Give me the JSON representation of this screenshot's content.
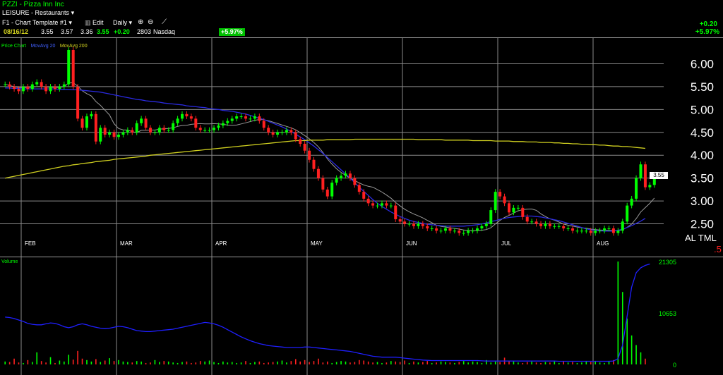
{
  "header": {
    "symbol_line": "PZZI - Pizza Inn Inc",
    "sector": "LEISURE - Restaurants",
    "template": "F1 - Chart Template #1",
    "edit_label": "Edit",
    "period": "Daily",
    "quote": {
      "date": "08/16/12",
      "open": "3.55",
      "high": "3.57",
      "low": "3.36",
      "close": "3.55",
      "change": "+0.20",
      "volume": "2803",
      "exchange": "Nasdaq"
    },
    "pct_badge": "+5.97%",
    "right_change": "+0.20",
    "right_pct": "+5.97%"
  },
  "price_panel": {
    "legend_title": "Price Chart",
    "legend_ma20": "MovAvg 20",
    "legend_ma200": "MovAvg 200",
    "last_price_label": "3.55",
    "corner_text": "AL TML",
    "corner_sub": ".5"
  },
  "volume_panel": {
    "legend_title": "Volume"
  },
  "colors": {
    "up": "#00ff00",
    "down": "#ff2020",
    "ma20": "#2a2ae0",
    "ma200": "#d0d020",
    "thin_ma": "#9a9a9a",
    "grid": "#8a8a8a",
    "axis_text": "#ffffff",
    "volume_line": "#1f1fff"
  },
  "chart_data": [
    {
      "type": "candlestick",
      "title": "PZZI - Pizza Inn Inc",
      "months": [
        "FEB",
        "MAR",
        "APR",
        "MAY",
        "JUN",
        "JUL",
        "AUG"
      ],
      "y_ticks": [
        "6.00",
        "5.50",
        "5.00",
        "4.50",
        "4.00",
        "3.50",
        "3.00",
        "2.50"
      ],
      "ylim": [
        2.0,
        6.5
      ],
      "close": [
        5.55,
        5.5,
        5.45,
        5.4,
        5.5,
        5.45,
        5.55,
        5.6,
        5.5,
        5.4,
        5.5,
        5.45,
        5.5,
        5.55,
        6.3,
        5.5,
        4.8,
        4.6,
        4.85,
        4.9,
        4.3,
        4.6,
        4.45,
        4.5,
        4.4,
        4.45,
        4.5,
        4.55,
        4.5,
        4.7,
        4.8,
        4.6,
        4.5,
        4.5,
        4.6,
        4.55,
        4.55,
        4.7,
        4.8,
        4.9,
        4.85,
        4.8,
        4.6,
        4.55,
        4.55,
        4.55,
        4.6,
        4.65,
        4.7,
        4.75,
        4.8,
        4.85,
        4.85,
        4.8,
        4.8,
        4.85,
        4.75,
        4.6,
        4.5,
        4.45,
        4.5,
        4.5,
        4.55,
        4.5,
        4.35,
        4.25,
        4.1,
        3.9,
        3.7,
        3.5,
        3.25,
        3.1,
        3.4,
        3.5,
        3.55,
        3.6,
        3.5,
        3.35,
        3.2,
        3.05,
        2.95,
        2.9,
        2.9,
        2.95,
        2.9,
        2.9,
        2.6,
        2.55,
        2.5,
        2.5,
        2.45,
        2.5,
        2.45,
        2.4,
        2.4,
        2.35,
        2.35,
        2.4,
        2.35,
        2.35,
        2.3,
        2.3,
        2.35,
        2.35,
        2.4,
        2.45,
        2.5,
        2.8,
        3.2,
        3.1,
        2.95,
        2.75,
        2.85,
        2.85,
        2.65,
        2.55,
        2.55,
        2.5,
        2.45,
        2.5,
        2.45,
        2.45,
        2.45,
        2.4,
        2.4,
        2.35,
        2.35,
        2.35,
        2.35,
        2.3,
        2.35,
        2.35,
        2.4,
        2.4,
        2.3,
        2.35,
        2.55,
        2.9,
        3.05,
        3.5,
        3.8,
        3.3,
        3.35,
        3.55
      ],
      "ma20": [
        5.47,
        5.47,
        5.46,
        5.46,
        5.45,
        5.45,
        5.45,
        5.45,
        5.45,
        5.45,
        5.45,
        5.45,
        5.44,
        5.44,
        5.44,
        5.43,
        5.43,
        5.42,
        5.41,
        5.4,
        5.39,
        5.38,
        5.36,
        5.34,
        5.32,
        5.3,
        5.28,
        5.26,
        5.24,
        5.22,
        5.21,
        5.19,
        5.18,
        5.17,
        5.16,
        5.14,
        5.13,
        5.12,
        5.11,
        5.1,
        5.08,
        5.07,
        5.06,
        5.05,
        5.04,
        5.02,
        5.01,
        5.0,
        4.98,
        4.97,
        4.96,
        4.94,
        4.92,
        4.9,
        4.87,
        4.84,
        4.81,
        4.78,
        4.74,
        4.7,
        4.66,
        4.62,
        4.57,
        4.52,
        4.46,
        4.4,
        4.34,
        4.27,
        4.2,
        4.12,
        4.04,
        3.95,
        3.86,
        3.77,
        3.68,
        3.59,
        3.5,
        3.4,
        3.3,
        3.21,
        3.12,
        3.03,
        2.95,
        2.88,
        2.82,
        2.76,
        2.71,
        2.66,
        2.62,
        2.58,
        2.55,
        2.53,
        2.51,
        2.49,
        2.48,
        2.47,
        2.46,
        2.45,
        2.45,
        2.45,
        2.45,
        2.45,
        2.46,
        2.47,
        2.48,
        2.5,
        2.52,
        2.55,
        2.57,
        2.6,
        2.62,
        2.64,
        2.65,
        2.66,
        2.67,
        2.67,
        2.67,
        2.66,
        2.65,
        2.63,
        2.61,
        2.59,
        2.57,
        2.54,
        2.51,
        2.48,
        2.45,
        2.42,
        2.39,
        2.37,
        2.36,
        2.35,
        2.34,
        2.34,
        2.34,
        2.36,
        2.38,
        2.42,
        2.46,
        2.51,
        2.56,
        2.62
      ],
      "ma200": [
        3.5,
        3.52,
        3.54,
        3.56,
        3.58,
        3.6,
        3.62,
        3.64,
        3.66,
        3.68,
        3.7,
        3.72,
        3.74,
        3.76,
        3.77,
        3.79,
        3.8,
        3.82,
        3.83,
        3.84,
        3.86,
        3.87,
        3.88,
        3.89,
        3.91,
        3.92,
        3.93,
        3.94,
        3.95,
        3.96,
        3.97,
        3.98,
        4.0,
        4.01,
        4.02,
        4.03,
        4.04,
        4.05,
        4.06,
        4.07,
        4.08,
        4.09,
        4.1,
        4.11,
        4.12,
        4.13,
        4.14,
        4.15,
        4.16,
        4.17,
        4.18,
        4.19,
        4.2,
        4.21,
        4.22,
        4.23,
        4.24,
        4.25,
        4.26,
        4.27,
        4.28,
        4.29,
        4.3,
        4.31,
        4.32,
        4.32,
        4.32,
        4.33,
        4.33,
        4.33,
        4.33,
        4.34,
        4.34,
        4.34,
        4.34,
        4.34,
        4.34,
        4.35,
        4.35,
        4.35,
        4.35,
        4.35,
        4.35,
        4.35,
        4.35,
        4.35,
        4.35,
        4.35,
        4.35,
        4.35,
        4.35,
        4.34,
        4.34,
        4.34,
        4.34,
        4.34,
        4.34,
        4.33,
        4.33,
        4.33,
        4.33,
        4.33,
        4.33,
        4.32,
        4.32,
        4.32,
        4.32,
        4.32,
        4.31,
        4.31,
        4.31,
        4.31,
        4.3,
        4.3,
        4.3,
        4.29,
        4.29,
        4.29,
        4.28,
        4.28,
        4.28,
        4.27,
        4.27,
        4.26,
        4.26,
        4.25,
        4.25,
        4.24,
        4.24,
        4.23,
        4.23,
        4.22,
        4.22,
        4.21,
        4.2,
        4.2,
        4.19,
        4.19,
        4.18,
        4.17,
        4.16,
        4.15
      ]
    },
    {
      "type": "bar",
      "title": "Volume",
      "y_ticks": [
        "21305",
        "10653",
        "0"
      ],
      "ylim": [
        0,
        21305
      ],
      "values": [
        600,
        500,
        1200,
        400,
        300,
        900,
        500,
        2500,
        700,
        400,
        1500,
        300,
        800,
        600,
        2000,
        1000,
        2800,
        1200,
        900,
        600,
        1100,
        500,
        800,
        1300,
        700,
        900,
        600,
        500,
        400,
        700,
        600,
        300,
        400,
        900,
        500,
        700,
        600,
        400,
        300,
        500,
        600,
        300,
        400,
        700,
        600,
        800,
        500,
        300,
        600,
        400,
        500,
        300,
        400,
        700,
        300,
        500,
        600,
        300,
        400,
        500,
        600,
        800,
        400,
        700,
        1100,
        600,
        900,
        500,
        700,
        1200,
        400,
        600,
        300,
        500,
        700,
        600,
        400,
        500,
        900,
        800,
        600,
        400,
        500,
        300,
        400,
        700,
        600,
        500,
        800,
        300,
        600,
        400,
        500,
        700,
        300,
        400,
        600,
        500,
        400,
        300,
        500,
        700,
        400,
        600,
        500,
        300,
        900,
        400,
        600,
        500,
        1400,
        800,
        700,
        400,
        300,
        500,
        600,
        400,
        300,
        500,
        400,
        700,
        300,
        600,
        400,
        500,
        300,
        400,
        600,
        500,
        700,
        400,
        300,
        600,
        900,
        21305,
        15000,
        9500,
        6000,
        4000,
        2500,
        1200
      ],
      "volume_ma": [
        9800,
        9700,
        9500,
        9200,
        8900,
        8500,
        8300,
        8200,
        8200,
        8400,
        8600,
        8500,
        8200,
        7800,
        7600,
        7800,
        8200,
        8400,
        8200,
        7900,
        7700,
        7500,
        7400,
        7500,
        7700,
        7900,
        7800,
        7600,
        7300,
        7000,
        6900,
        6800,
        6800,
        6900,
        7000,
        7100,
        7200,
        7300,
        7500,
        7700,
        7900,
        8100,
        8300,
        8500,
        8700,
        8600,
        8400,
        8100,
        7700,
        7200,
        6700,
        6200,
        5700,
        5300,
        4900,
        4600,
        4300,
        4100,
        3900,
        3800,
        3700,
        3600,
        3500,
        3500,
        3500,
        3500,
        3600,
        3600,
        3500,
        3400,
        3300,
        3200,
        3100,
        3000,
        2900,
        2800,
        2700,
        2500,
        2300,
        2100,
        1900,
        1700,
        1600,
        1500,
        1500,
        1500,
        1500,
        1400,
        1300,
        1200,
        1100,
        1000,
        900,
        850,
        800,
        800,
        800,
        800,
        800,
        800,
        800,
        800,
        800,
        800,
        800,
        750,
        700,
        700,
        700,
        700,
        700,
        700,
        700,
        700,
        700,
        700,
        700,
        700,
        700,
        700,
        700,
        700,
        650,
        650,
        650,
        650,
        650,
        650,
        650,
        650,
        650,
        650,
        650,
        650,
        700,
        1200,
        4000,
        10000,
        16000,
        19000,
        20000,
        20500,
        20800
      ]
    }
  ]
}
